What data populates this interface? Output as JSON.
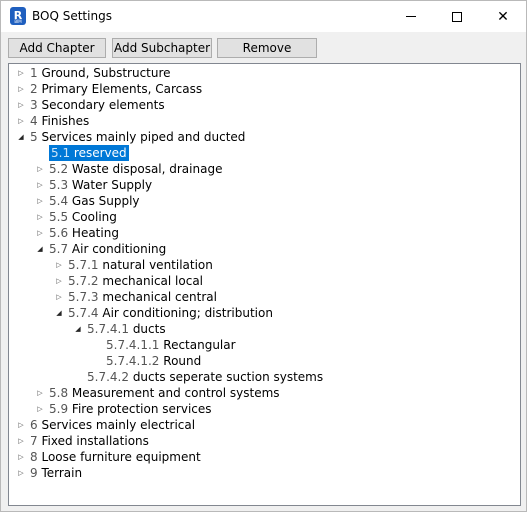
{
  "window": {
    "title": "BOQ Settings",
    "app_icon_letter": "R",
    "app_icon_sub": "BIM",
    "min_glyph": "",
    "close_glyph": "✕"
  },
  "toolbar": {
    "add_chapter": "Add Chapter",
    "add_subchapter": "Add Subchapter",
    "remove": "Remove"
  },
  "colors": {
    "selection": "#0078d7"
  },
  "tree": {
    "expander_closed": "▷",
    "expander_open": "◢",
    "rows": [
      {
        "num": "1",
        "label": "Ground, Substructure",
        "expander": "closed"
      },
      {
        "num": "2",
        "label": "Primary Elements, Carcass",
        "expander": "closed"
      },
      {
        "num": "3",
        "label": "Secondary elements",
        "expander": "closed"
      },
      {
        "num": "4",
        "label": "Finishes",
        "expander": "closed"
      },
      {
        "num": "5",
        "label": "Services mainly piped and ducted",
        "expander": "open"
      },
      {
        "num": "5.1",
        "label": "reserved",
        "expander": "none",
        "selected": true
      },
      {
        "num": "5.2",
        "label": "Waste disposal, drainage",
        "expander": "closed"
      },
      {
        "num": "5.3",
        "label": "Water Supply",
        "expander": "closed"
      },
      {
        "num": "5.4",
        "label": "Gas Supply",
        "expander": "closed"
      },
      {
        "num": "5.5",
        "label": "Cooling",
        "expander": "closed"
      },
      {
        "num": "5.6",
        "label": "Heating",
        "expander": "closed"
      },
      {
        "num": "5.7",
        "label": "Air conditioning",
        "expander": "open"
      },
      {
        "num": "5.7.1",
        "label": "natural ventilation",
        "expander": "closed"
      },
      {
        "num": "5.7.2",
        "label": "mechanical local",
        "expander": "closed"
      },
      {
        "num": "5.7.3",
        "label": "mechanical central",
        "expander": "closed"
      },
      {
        "num": "5.7.4",
        "label": "Air conditioning; distribution",
        "expander": "open"
      },
      {
        "num": "5.7.4.1",
        "label": "ducts",
        "expander": "open"
      },
      {
        "num": "5.7.4.1.1",
        "label": "Rectangular",
        "expander": "none"
      },
      {
        "num": "5.7.4.1.2",
        "label": "Round",
        "expander": "none"
      },
      {
        "num": "5.7.4.2",
        "label": "ducts seperate suction systems",
        "expander": "none"
      },
      {
        "num": "5.8",
        "label": "Measurement and control systems",
        "expander": "closed"
      },
      {
        "num": "5.9",
        "label": "Fire protection services",
        "expander": "closed"
      },
      {
        "num": "6",
        "label": "Services mainly electrical",
        "expander": "closed"
      },
      {
        "num": "7",
        "label": "Fixed installations",
        "expander": "closed"
      },
      {
        "num": "8",
        "label": "Loose furniture equipment",
        "expander": "closed"
      },
      {
        "num": "9",
        "label": "Terrain",
        "expander": "closed"
      }
    ]
  }
}
